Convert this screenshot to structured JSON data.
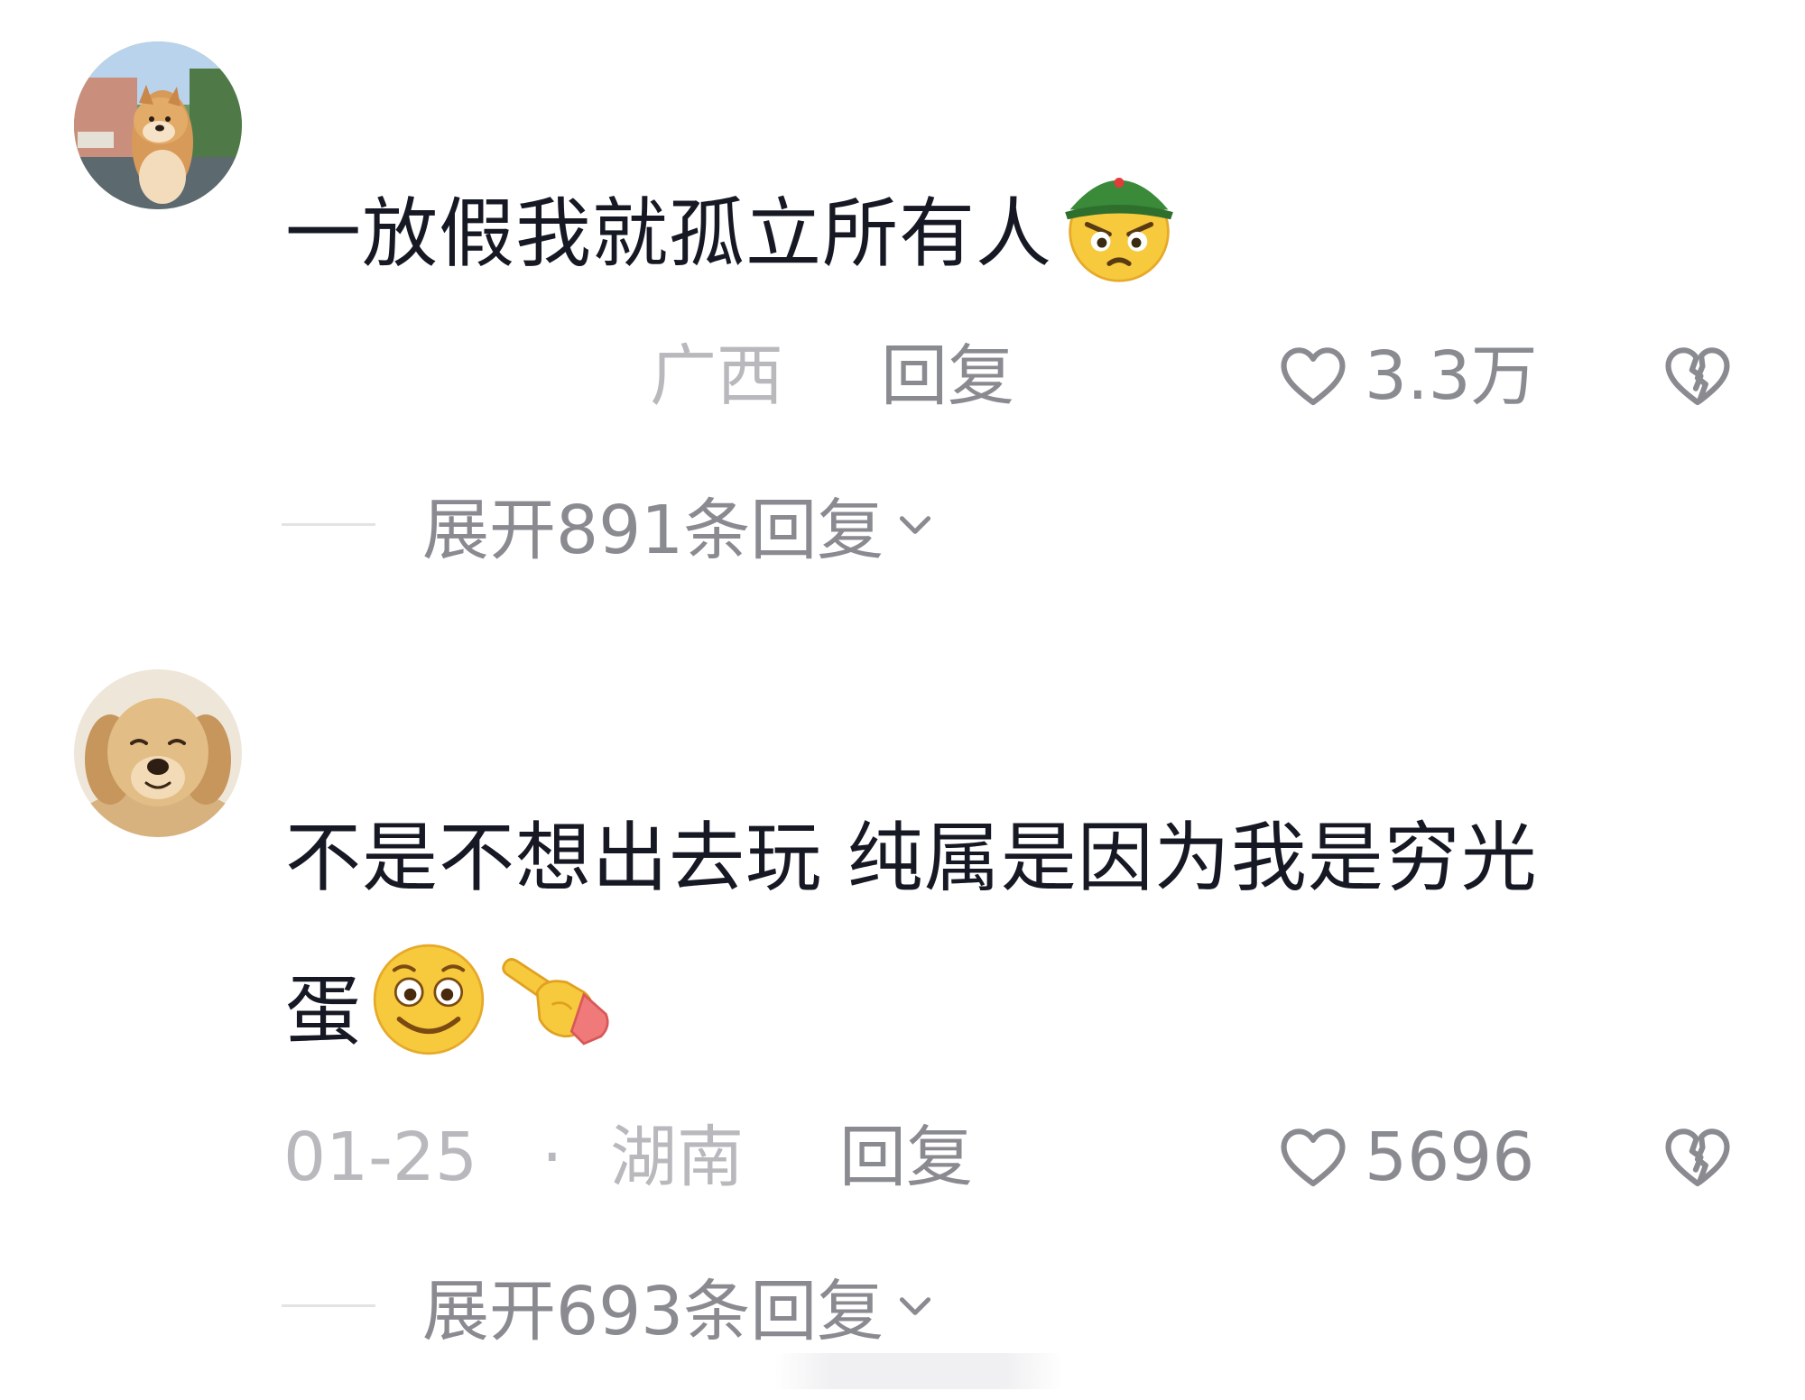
{
  "comments": [
    {
      "avatar": "shiba-dog-avatar",
      "text": "一放假我就孤立所有人",
      "emojis": [
        "angry-army-cap-emoji"
      ],
      "date": "",
      "region": "广西",
      "reply_label": "回复",
      "likes": "3.3万",
      "expand_label": "展开891条回复"
    },
    {
      "avatar": "golden-retriever-avatar",
      "text_line1": "不是不想出去玩 纯属是因为我是穷光",
      "text_line2": "蛋",
      "emojis": [
        "awkward-smile-emoji",
        "pointing-hand-emoji"
      ],
      "date": "01-25",
      "separator": "·",
      "region": "湖南",
      "reply_label": "回复",
      "likes": "5696",
      "expand_label": "展开693条回复"
    }
  ],
  "colors": {
    "text_primary": "#161823",
    "text_secondary": "#8a8b91",
    "text_tertiary": "#b8b8bd",
    "divider": "#e3e3e6"
  }
}
